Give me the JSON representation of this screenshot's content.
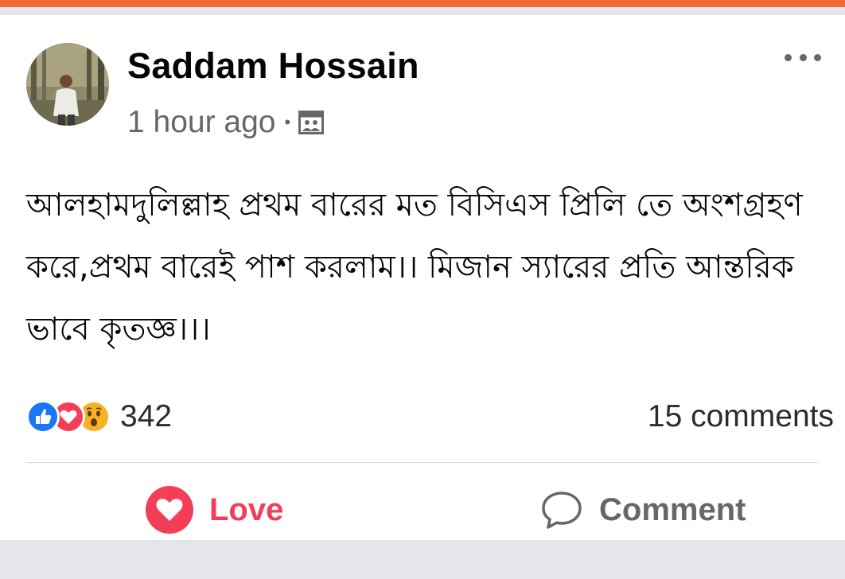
{
  "post": {
    "author": "Saddam Hossain",
    "time": "1 hour ago",
    "separator": "•",
    "audience_icon": "public-photo-icon",
    "text": "আলহামদুলিল্লাহ প্রথম বারের মত বিসিএস প্রিলি তে অংশগ্রহণ করে,প্রথম বারেই পাশ করলাম।। মিজান স্যারের প্রতি আন্তরিক ভাবে কৃতজ্ঞ।।।"
  },
  "reactions": {
    "icons": [
      "like-icon",
      "love-icon",
      "wow-icon"
    ],
    "count": "342",
    "comments": "15 comments"
  },
  "actions": {
    "love_label": "Love",
    "comment_label": "Comment"
  },
  "colors": {
    "accent_bar": "#f26a3a",
    "love": "#f33e58",
    "like": "#1877f2",
    "wow": "#f7b125",
    "secondary_text": "#65676b"
  }
}
